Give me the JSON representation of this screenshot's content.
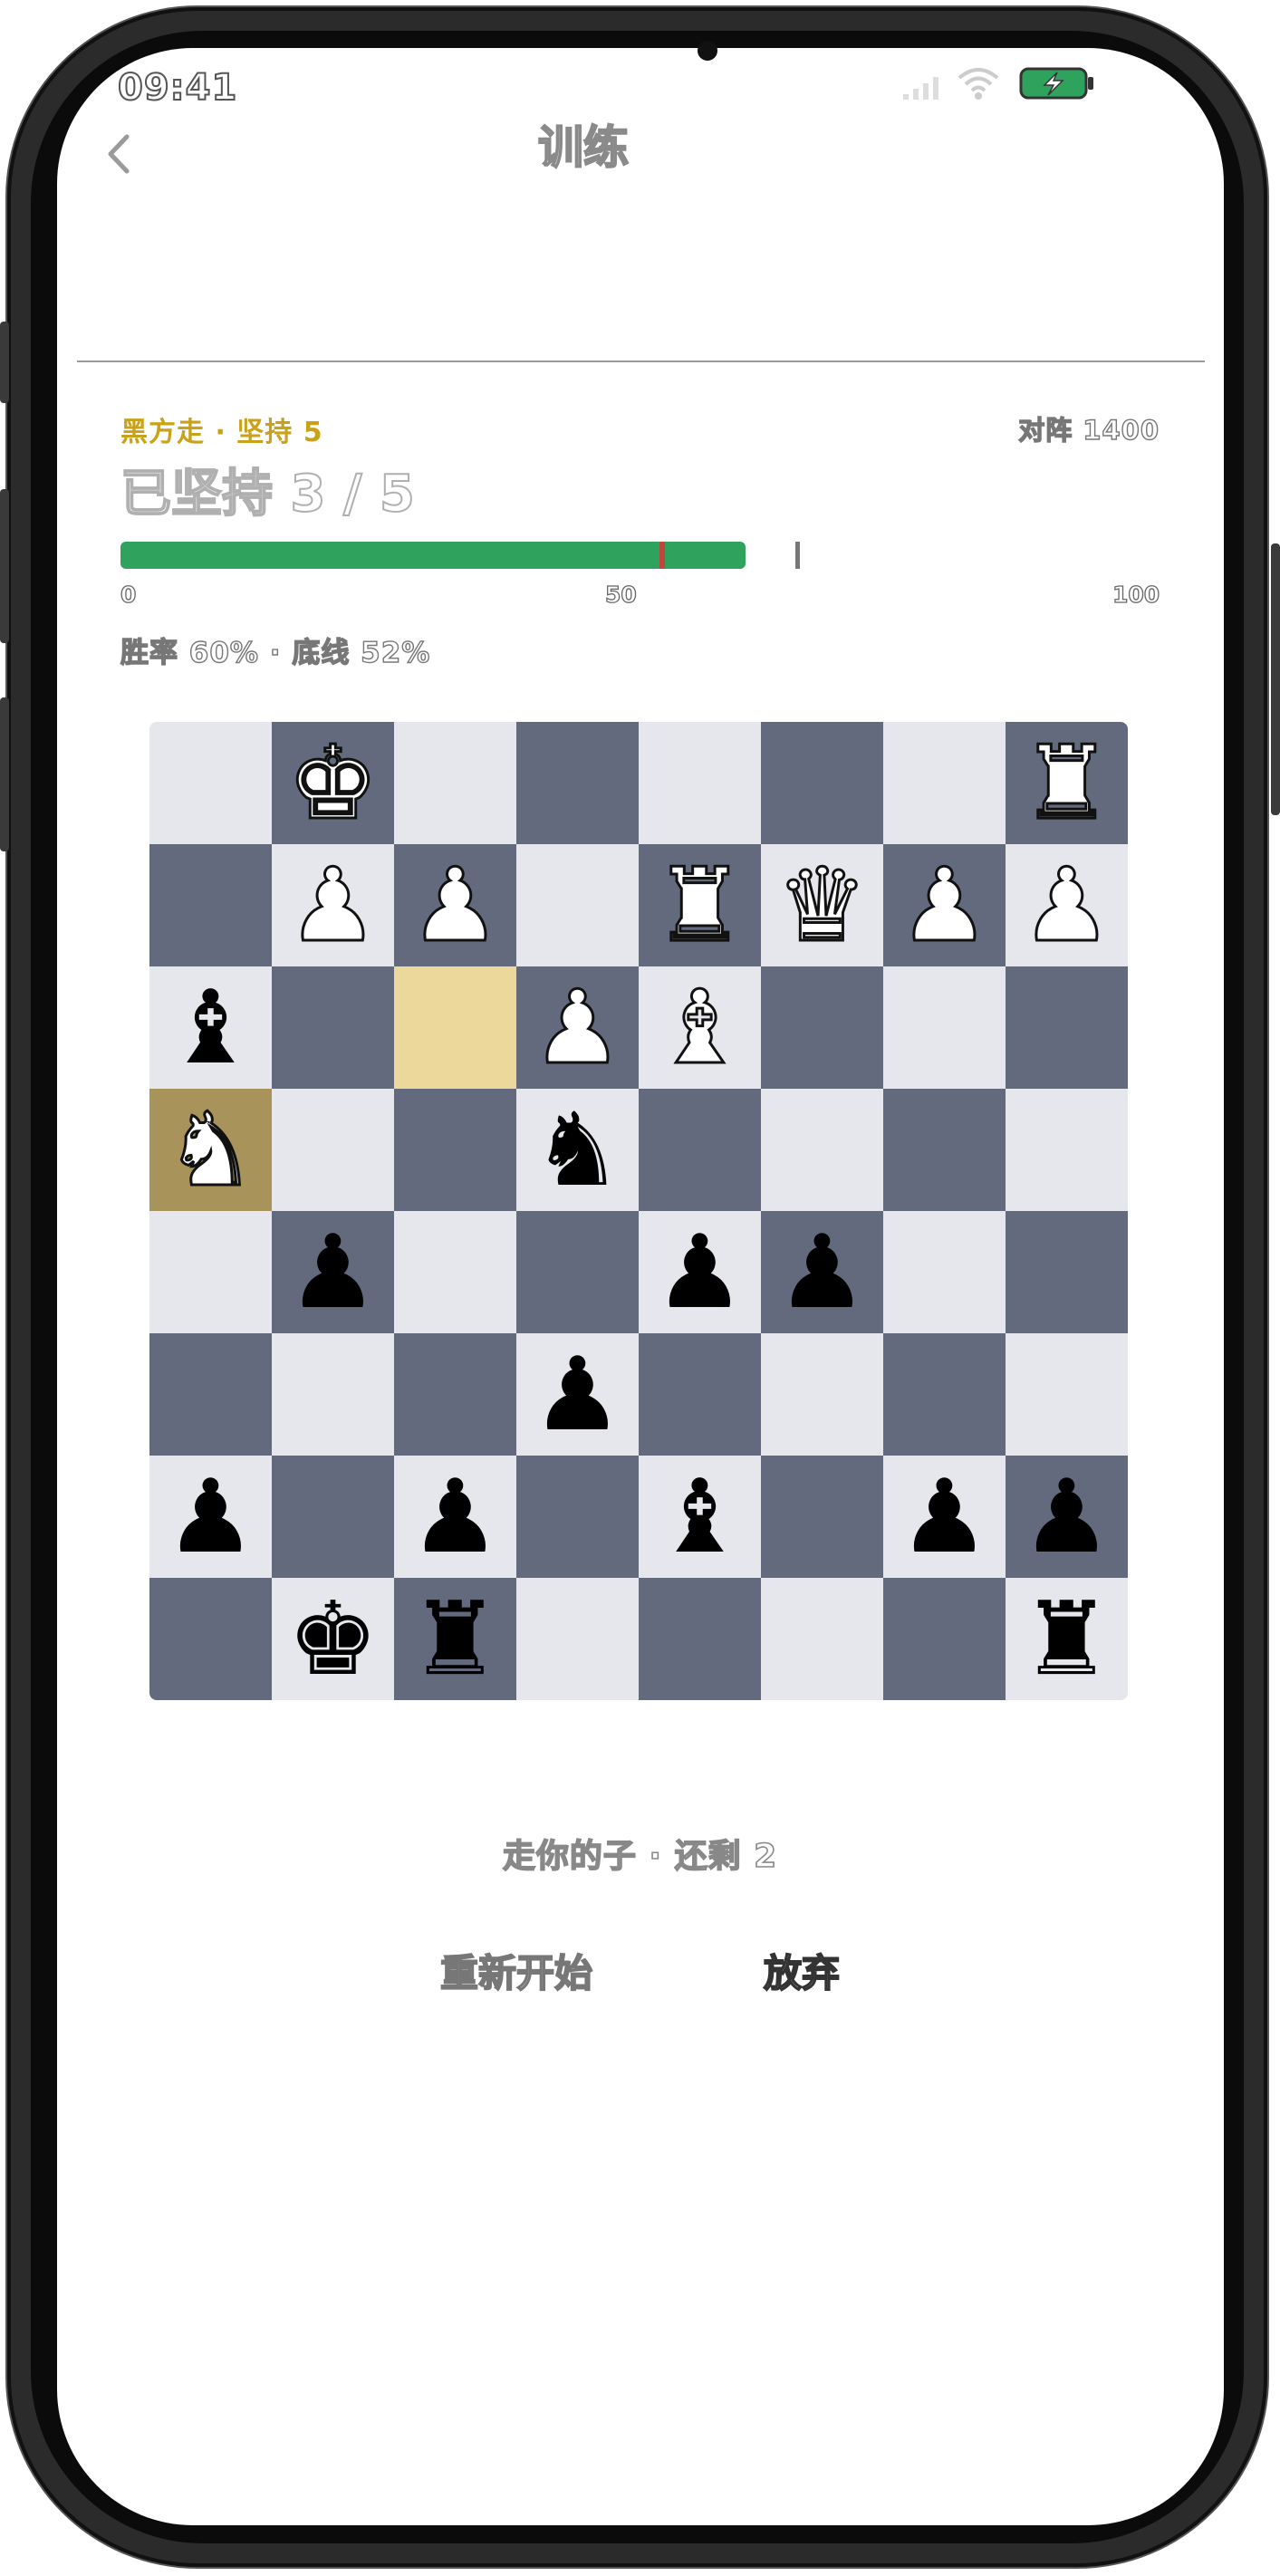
{
  "status_bar": {
    "time": "09:41"
  },
  "nav": {
    "title": "训练"
  },
  "training": {
    "status_line": "黑方走 · 坚持 5",
    "opponent": "对阵 1400",
    "headline": "已坚持 3 / 5",
    "win_rate_percent": 60,
    "baseline_percent": 52,
    "scale_ticks": [
      "0",
      "50",
      "100"
    ],
    "rates_text": "胜率 60% · 底线 52%"
  },
  "board": {
    "ranks": [
      [
        "",
        "K",
        "",
        "",
        "",
        "",
        "",
        "R"
      ],
      [
        "",
        "P",
        "P",
        "",
        "R",
        "Q",
        "P",
        "P"
      ],
      [
        "b",
        "",
        "",
        "P",
        "B",
        "",
        "",
        ""
      ],
      [
        "N",
        "",
        "",
        "n",
        "",
        "",
        "",
        ""
      ],
      [
        "",
        "p",
        "",
        "",
        "p",
        "p",
        "",
        ""
      ],
      [
        "",
        "",
        "",
        "p",
        "",
        "",
        "",
        ""
      ],
      [
        "p",
        "",
        "p",
        "",
        "b",
        "",
        "p",
        "p"
      ],
      [
        "",
        "k",
        "r",
        "",
        "",
        "",
        "",
        "r"
      ]
    ],
    "highlight_target": [
      2,
      2
    ],
    "highlight_from": [
      3,
      0
    ]
  },
  "hint": "走你的子 · 还剩 2",
  "actions": {
    "restart_label": "重新开始",
    "resign_label": "放弃"
  },
  "colors": {
    "accent_gold": "#c9a21a",
    "bar_green": "#2fa35e",
    "baseline_red": "#c0463c",
    "square_light": "#e6e7ec",
    "square_dark": "#636a7d"
  }
}
